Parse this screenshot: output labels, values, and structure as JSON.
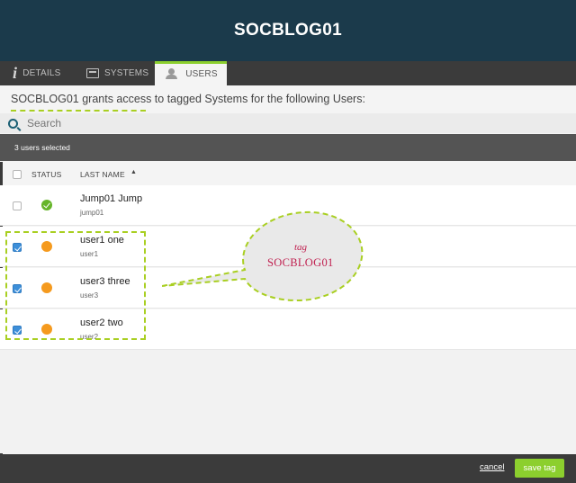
{
  "header": {
    "title": "SOCBLOG01"
  },
  "tabs": [
    {
      "label": "DETAILS",
      "icon": "info-icon"
    },
    {
      "label": "SYSTEMS",
      "icon": "systems-icon"
    },
    {
      "label": "USERS",
      "icon": "users-icon",
      "active": true
    }
  ],
  "description": "SOCBLOG01 grants access to tagged Systems for the following Users:",
  "search": {
    "placeholder": "Search",
    "value": ""
  },
  "selection": {
    "text": "3 users selected"
  },
  "columns": {
    "status": "STATUS",
    "last_name": "LAST NAME",
    "sort": "ascending"
  },
  "rows": [
    {
      "name": "Jump01 Jump",
      "username": "jump01",
      "checked": false,
      "status": "active",
      "status_color": "#66b52b"
    },
    {
      "name": "user1 one",
      "username": "user1",
      "checked": true,
      "status": "pending",
      "status_color": "#f59a1e"
    },
    {
      "name": "user3 three",
      "username": "user3",
      "checked": true,
      "status": "pending",
      "status_color": "#f59a1e"
    },
    {
      "name": "user2 two",
      "username": "user2",
      "checked": true,
      "status": "pending",
      "status_color": "#f59a1e"
    }
  ],
  "annotation": {
    "line1": "tag",
    "line2": "SOCBLOG01",
    "color": "#a9cf22"
  },
  "footer": {
    "cancel_label": "cancel",
    "save_label": "save tag"
  },
  "colors": {
    "header_bg": "#1b3a4b",
    "accent": "#8ccf2e",
    "checkbox_on": "#3d8fd9"
  }
}
